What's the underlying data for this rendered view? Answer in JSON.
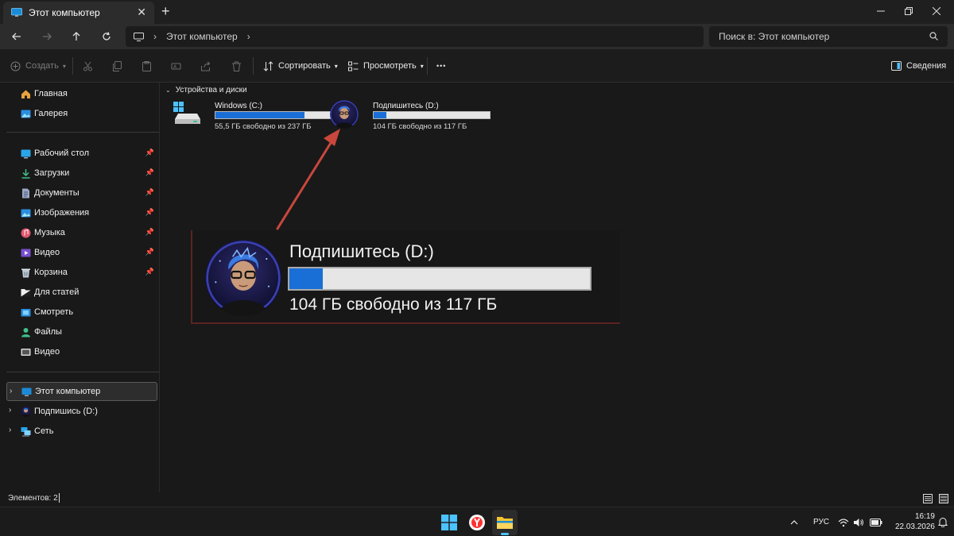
{
  "window": {
    "tab_title": "Этот компьютер",
    "new_tab": "+",
    "tab_close": "✕"
  },
  "address": {
    "crumb": "Этот компьютер",
    "search_placeholder": "Поиск в: Этот компьютер"
  },
  "toolbar": {
    "create_label": "Создать",
    "sort_label": "Сортировать",
    "view_label": "Просмотреть",
    "more_label": "•••",
    "details_label": "Сведения"
  },
  "sidebar": {
    "quick": [
      {
        "label": "Главная",
        "icon": "home-icon"
      },
      {
        "label": "Галерея",
        "icon": "gallery-icon"
      }
    ],
    "pinned": [
      {
        "label": "Рабочий стол",
        "icon": "desktop-icon"
      },
      {
        "label": "Загрузки",
        "icon": "download-icon"
      },
      {
        "label": "Документы",
        "icon": "documents-icon"
      },
      {
        "label": "Изображения",
        "icon": "pictures-icon"
      },
      {
        "label": "Музыка",
        "icon": "music-icon"
      },
      {
        "label": "Видео",
        "icon": "video-icon"
      },
      {
        "label": "Корзина",
        "icon": "recycle-bin-icon"
      },
      {
        "label": "Для статей",
        "icon": "folder-icon"
      },
      {
        "label": "Смотреть",
        "icon": "folder-icon"
      },
      {
        "label": "Файлы",
        "icon": "user-folder-icon"
      },
      {
        "label": "Видео",
        "icon": "film-folder-icon"
      }
    ],
    "tree": [
      {
        "label": "Этот компьютер",
        "icon": "this-pc-icon",
        "selected": true
      },
      {
        "label": "Подпишись (D:)",
        "icon": "drive-d-icon",
        "selected": false
      },
      {
        "label": "Сеть",
        "icon": "network-icon",
        "selected": false
      }
    ]
  },
  "main": {
    "group_title": "Устройства и диски",
    "drives": [
      {
        "name": "Windows (C:)",
        "free_text": "55,5 ГБ свободно из 237 ГБ",
        "used_fraction": 0.766
      },
      {
        "name": "Подпишитесь (D:)",
        "free_text": "104 ГБ свободно из 117 ГБ",
        "used_fraction": 0.111
      }
    ],
    "callout": {
      "name": "Подпишитесь (D:)",
      "free_text": "104 ГБ свободно из 117 ГБ",
      "used_fraction": 0.111
    }
  },
  "status": {
    "items_count": "Элементов: 2"
  },
  "taskbar": {
    "lang": "РУС",
    "time": "16:19",
    "date": "22.03.2026"
  },
  "colors": {
    "accent": "#1a6fd6",
    "arrow": "#c9473d",
    "background": "#191919"
  }
}
